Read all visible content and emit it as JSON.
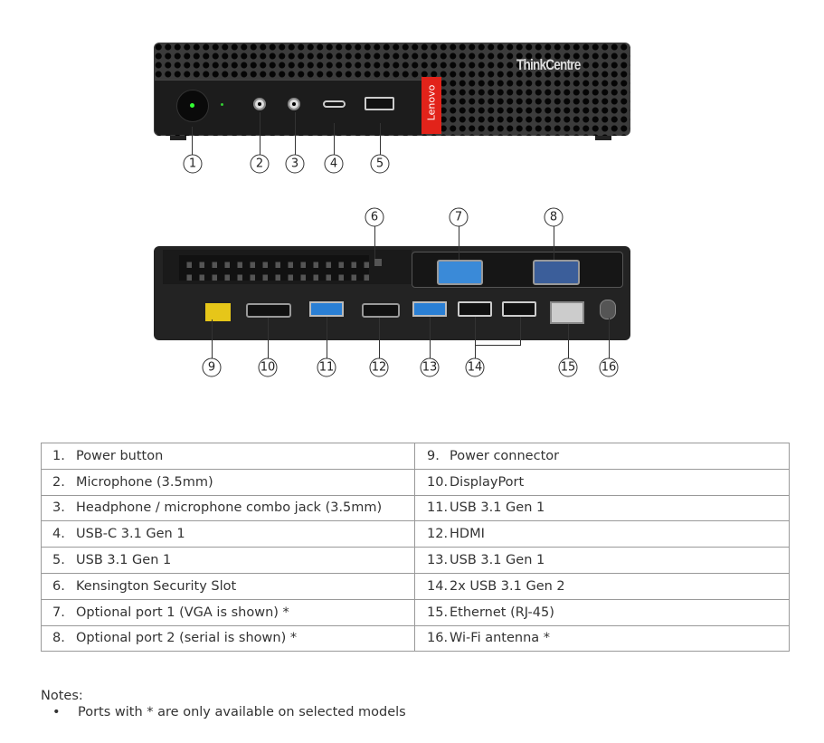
{
  "front_image": {
    "brand_logo": "ThinkCentre",
    "side_logo": "Lenovo",
    "callouts": [
      "1",
      "2",
      "3",
      "4",
      "5"
    ]
  },
  "rear_image": {
    "callouts_top": [
      "6",
      "7",
      "8"
    ],
    "callouts_bottom": [
      "9",
      "10",
      "11",
      "12",
      "13",
      "14",
      "15",
      "16"
    ]
  },
  "table": {
    "rows": [
      [
        {
          "num": "1.",
          "label": "Power button"
        },
        {
          "num": "9.",
          "label": "Power connector"
        }
      ],
      [
        {
          "num": "2.",
          "label": "Microphone (3.5mm)"
        },
        {
          "num": "10.",
          "label": "DisplayPort"
        }
      ],
      [
        {
          "num": "3.",
          "label": "Headphone / microphone combo jack (3.5mm)"
        },
        {
          "num": "11.",
          "label": "USB 3.1 Gen 1"
        }
      ],
      [
        {
          "num": "4.",
          "label": "USB-C 3.1 Gen 1"
        },
        {
          "num": "12.",
          "label": "HDMI"
        }
      ],
      [
        {
          "num": "5.",
          "label": "USB 3.1 Gen 1"
        },
        {
          "num": "13.",
          "label": "USB 3.1 Gen 1"
        }
      ],
      [
        {
          "num": "6.",
          "label": "Kensington Security Slot"
        },
        {
          "num": "14.",
          "label": "2x USB 3.1 Gen 2"
        }
      ],
      [
        {
          "num": "7.",
          "label": "Optional port 1 (VGA is shown) *"
        },
        {
          "num": "15.",
          "label": "Ethernet (RJ-45)"
        }
      ],
      [
        {
          "num": "8.",
          "label": "Optional port 2 (serial is shown) *"
        },
        {
          "num": "16.",
          "label": "Wi-Fi antenna *"
        }
      ]
    ]
  },
  "notes": {
    "title": "Notes:",
    "bullet_symbol": "•",
    "items": [
      "Ports with * are only available on selected models"
    ]
  }
}
